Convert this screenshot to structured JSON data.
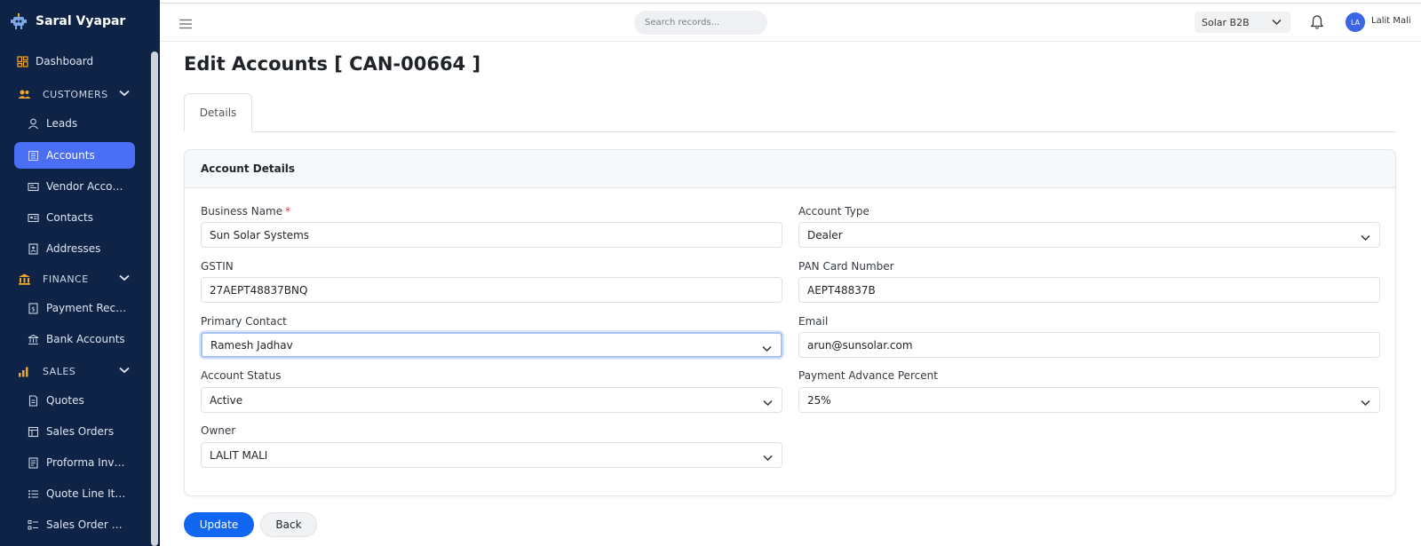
{
  "app": {
    "name": "Saral Vyapar"
  },
  "sidebar": {
    "dashboard": "Dashboard",
    "sections": {
      "customers": "CUSTOMERS",
      "finance": "FINANCE",
      "sales": "SALES"
    },
    "items": {
      "leads": "Leads",
      "accounts": "Accounts",
      "vendor_accounts": "Vendor Accounts",
      "contacts": "Contacts",
      "addresses": "Addresses",
      "payment_receipts": "Payment Recei...",
      "bank_accounts": "Bank Accounts",
      "quotes": "Quotes",
      "sales_orders": "Sales Orders",
      "proforma_invoices": "Proforma Invoi...",
      "quote_line_items": "Quote Line Ite...",
      "sales_order_line_items": "Sales Order Li..."
    },
    "colors": {
      "background": "#0f2346",
      "active": "#4a6ff5",
      "section_icon": "#f5a623"
    }
  },
  "topbar": {
    "search_placeholder": "Search records...",
    "company": "Solar B2B",
    "user_initials": "LA",
    "user_name": "Lalit Mali"
  },
  "page": {
    "title": "Edit Accounts [ CAN-00664 ]",
    "tab_details": "Details",
    "card_title": "Account Details"
  },
  "form": {
    "business_name": {
      "label": "Business Name",
      "required": "*",
      "value": "Sun Solar Systems"
    },
    "account_type": {
      "label": "Account Type",
      "value": "Dealer"
    },
    "gstin": {
      "label": "GSTIN",
      "value": "27AEPT48837BNQ"
    },
    "pan": {
      "label": "PAN Card Number",
      "value": "AEPT48837B"
    },
    "primary_contact": {
      "label": "Primary Contact",
      "value": "Ramesh Jadhav"
    },
    "email": {
      "label": "Email",
      "value": "arun@sunsolar.com"
    },
    "account_status": {
      "label": "Account Status",
      "value": "Active"
    },
    "payment_advance": {
      "label": "Payment Advance Percent",
      "value": "25%"
    },
    "owner": {
      "label": "Owner",
      "value": "LALIT MALI"
    }
  },
  "actions": {
    "update": "Update",
    "back": "Back"
  },
  "colors": {
    "primary": "#1167f2",
    "required": "#dc3545"
  }
}
